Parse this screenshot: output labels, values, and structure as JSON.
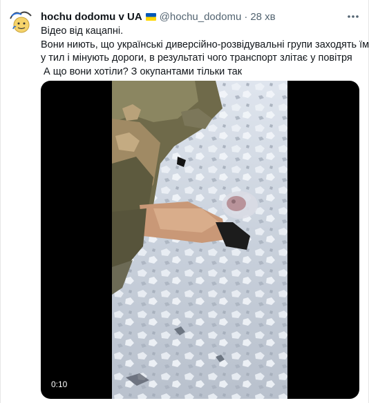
{
  "tweet": {
    "display_name": "hochu dodomu v UA",
    "handle": "@hochu_dodomu",
    "separator": "·",
    "time": "28 хв",
    "text_lines": [
      "Відео від кацапні.",
      "Вони ниють, що українські диверсійно-розвідувальні групи заходять їм",
      "у тил і мінують дороги, в результаті чого транспорт злітає у повітря",
      " А що вони хотіли? З окупантами тільки так"
    ]
  },
  "media": {
    "type": "video",
    "duration": "0:10"
  },
  "icons": {
    "avatar": "avatar-face-icon",
    "flag": "ukraine-flag-icon",
    "more": "more-options-icon"
  },
  "colors": {
    "secondary_text": "#536471",
    "primary_text": "#0f1419",
    "flag_blue": "#0057b7",
    "flag_yellow": "#ffd700"
  }
}
